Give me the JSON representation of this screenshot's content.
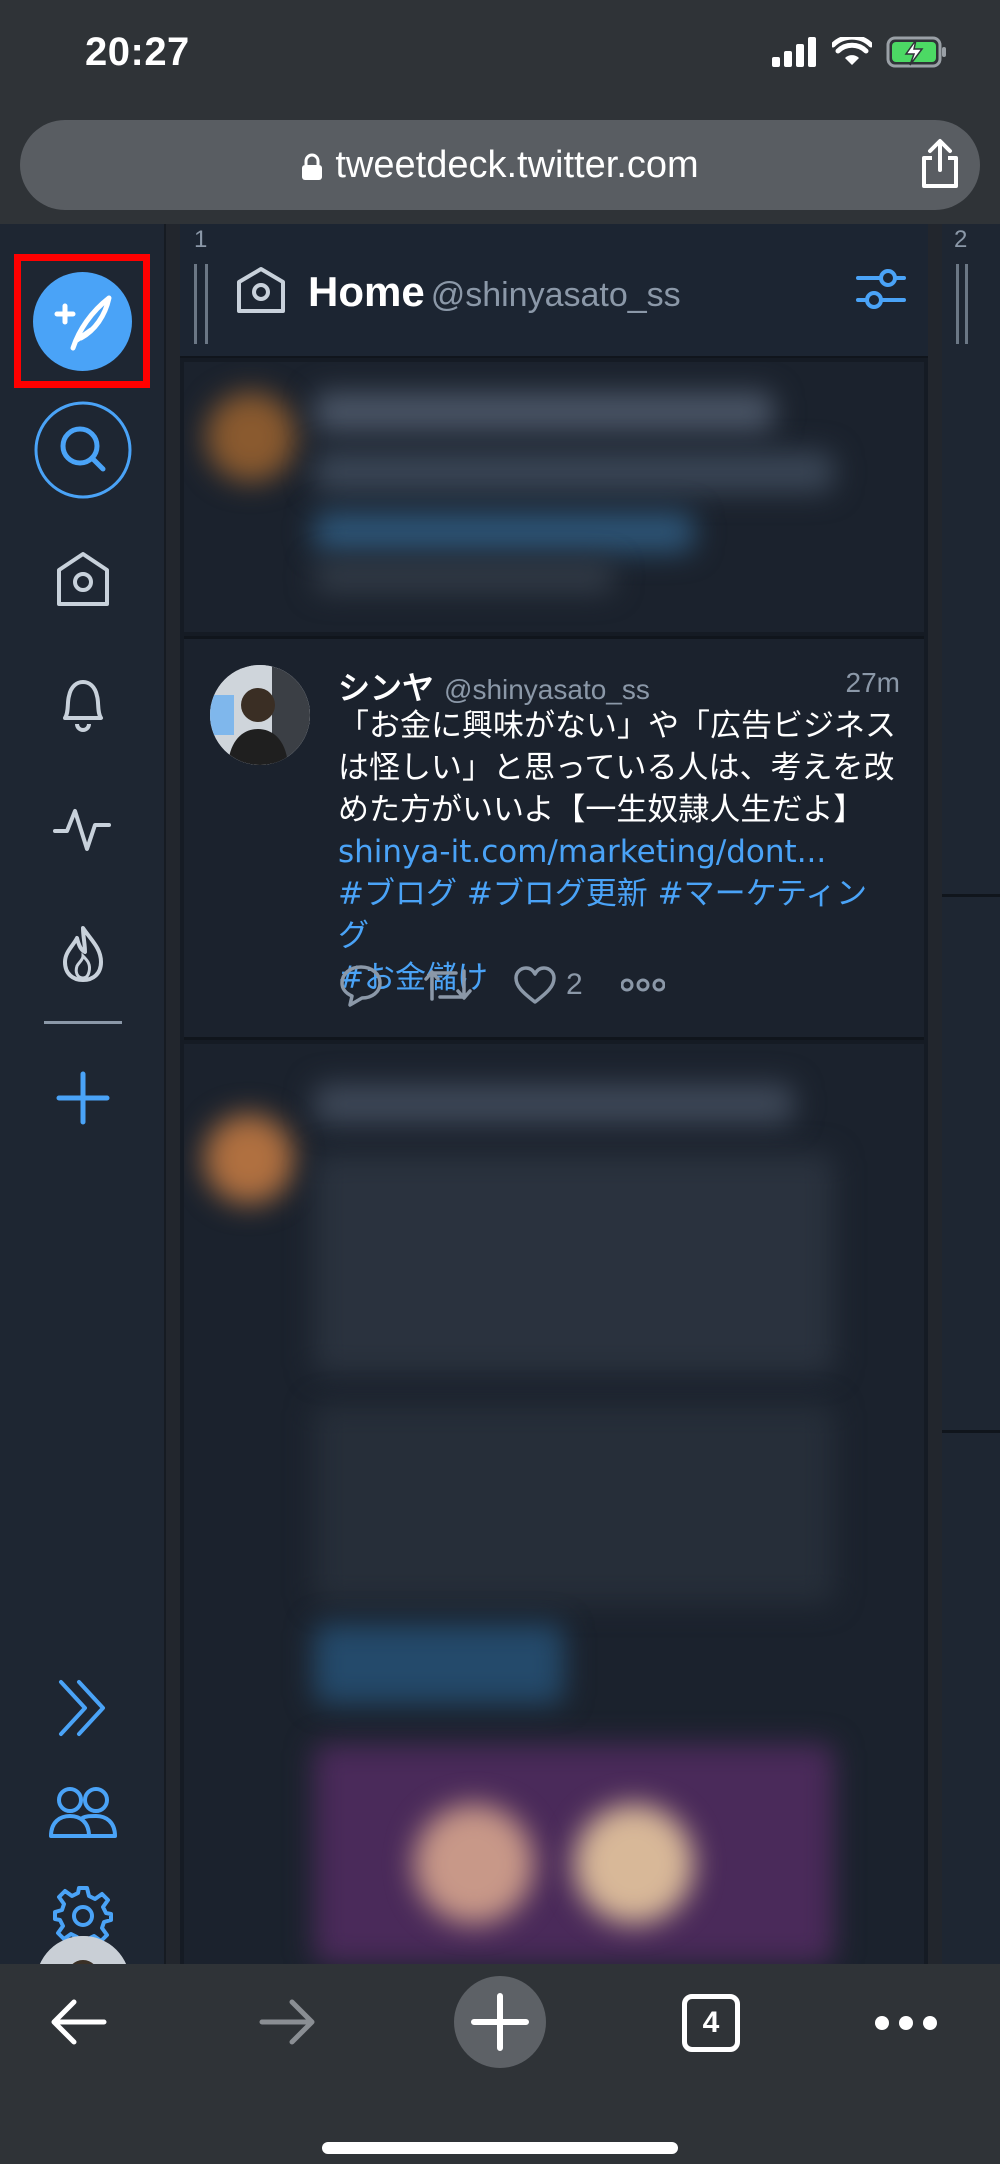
{
  "status_bar": {
    "time": "20:27"
  },
  "browser": {
    "url": "tweetdeck.twitter.com",
    "tab_count": "4"
  },
  "sidebar": {
    "items": [
      {
        "name": "compose-button",
        "icon": "compose-quill-icon"
      },
      {
        "name": "search-button",
        "icon": "search-icon"
      },
      {
        "name": "home-button",
        "icon": "home-icon"
      },
      {
        "name": "notifications-button",
        "icon": "bell-icon"
      },
      {
        "name": "activity-button",
        "icon": "activity-icon"
      },
      {
        "name": "trending-button",
        "icon": "flame-icon"
      },
      {
        "name": "add-column-button",
        "icon": "plus-icon"
      },
      {
        "name": "expand-button",
        "icon": "double-chevron-icon"
      },
      {
        "name": "accounts-button",
        "icon": "people-icon"
      },
      {
        "name": "settings-button",
        "icon": "gear-icon"
      }
    ]
  },
  "column": {
    "number": "1",
    "next_number": "2",
    "title": "Home",
    "handle": "@shinyasato_ss"
  },
  "tweet": {
    "name": "シンヤ",
    "handle": "@shinyasato_ss",
    "time": "27m",
    "lines": [
      "「お金に興味がない」や「広告ビジネス",
      "は怪しい」と思っている人は、考えを改",
      "めた方がいいよ【一生奴隷人生だよ】"
    ],
    "link": "shinya-it.com/marketing/dont...",
    "hashtags_1": "#ブログ #ブログ更新 #マーケティング",
    "hashtags_2": "#お金儲け",
    "likes": "2"
  },
  "colors": {
    "accent": "#4aa3f7",
    "highlight": "#ff0000"
  }
}
